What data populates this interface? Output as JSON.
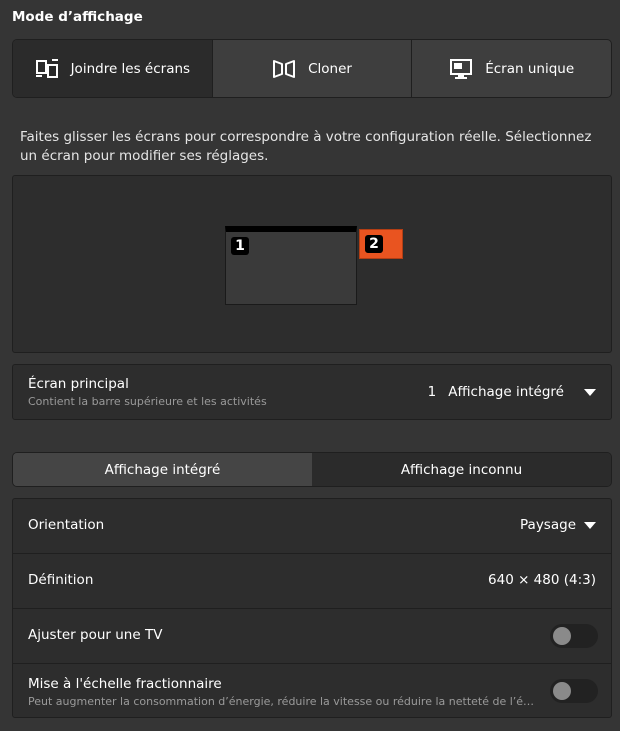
{
  "section_title": "Mode d’affichage",
  "modes": [
    {
      "label": "Joindre les écrans",
      "icon": "join-displays-icon",
      "active": true
    },
    {
      "label": "Cloner",
      "icon": "mirror-icon",
      "active": false
    },
    {
      "label": "Écran unique",
      "icon": "single-display-icon",
      "active": false
    }
  ],
  "description": "Faites glisser les écrans pour correspondre à votre configuration réelle. Sélectionnez un écran pour modifier ses réglages.",
  "arrangement": {
    "monitors": [
      {
        "number": "1",
        "color": "#3a3a3a"
      },
      {
        "number": "2",
        "color": "#e95420"
      }
    ]
  },
  "primary": {
    "title": "Écran principal",
    "subtitle": "Contient la barre supérieure et les activités",
    "index": "1",
    "name": "Affichage intégré"
  },
  "tabs": [
    {
      "label": "Affichage intégré",
      "active": true
    },
    {
      "label": "Affichage inconnu",
      "active": false
    }
  ],
  "settings": {
    "orientation": {
      "label": "Orientation",
      "value": "Paysage"
    },
    "resolution": {
      "label": "Définition",
      "value": "640 × 480 (4:3)"
    },
    "tv": {
      "label": "Ajuster pour une TV",
      "enabled": false
    },
    "fractional": {
      "label": "Mise à l'échelle fractionnaire",
      "subtitle": "Peut augmenter la consommation d’énergie, réduire la vitesse ou réduire la netteté de l’écran.",
      "enabled": false
    }
  },
  "colors": {
    "accent": "#e95420",
    "background": "#353535",
    "panel": "#2d2d2d"
  }
}
